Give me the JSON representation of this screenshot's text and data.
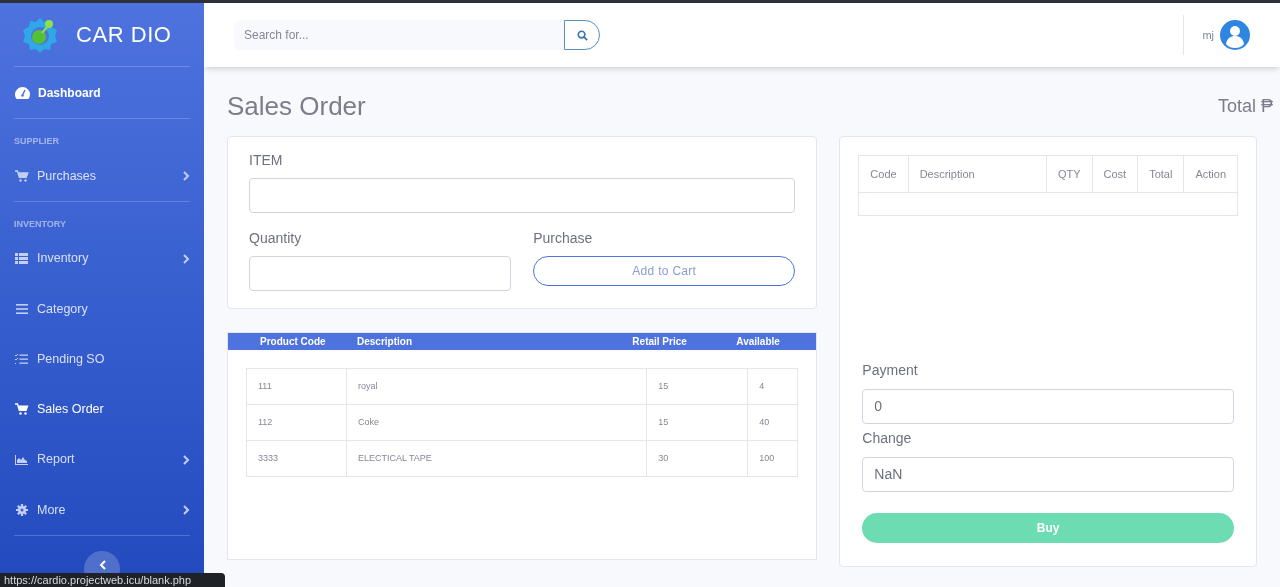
{
  "sidebar": {
    "brand": "CAR DIO",
    "dashboard": {
      "label": "Dashboard",
      "selected": false
    },
    "sections": [
      {
        "heading": "SUPPLIER",
        "items": [
          {
            "label": "Purchases",
            "expandable": true,
            "selected": false
          }
        ]
      },
      {
        "heading": "INVENTORY",
        "items": [
          {
            "label": "Inventory",
            "expandable": true,
            "selected": false
          },
          {
            "label": "Category",
            "expandable": false,
            "selected": false
          },
          {
            "label": "Pending SO",
            "expandable": false,
            "selected": false
          },
          {
            "label": "Sales Order",
            "expandable": false,
            "selected": true
          },
          {
            "label": "Report",
            "expandable": true,
            "selected": false
          },
          {
            "label": "More",
            "expandable": true,
            "selected": false
          }
        ]
      }
    ]
  },
  "topbar": {
    "search": {
      "placeholder": "Search for..."
    },
    "user": "mj"
  },
  "page": {
    "title": "Sales Order",
    "total": "Total ₱"
  },
  "item_form": {
    "item_label": "ITEM",
    "quantity_label": "Quantity",
    "purchase_label": "Purchase",
    "add_button": "Add to Cart"
  },
  "products": {
    "columns": [
      "Product Code",
      "Description",
      "Retail Price",
      "Available"
    ],
    "rows": [
      [
        "111",
        "royal",
        "15",
        "4"
      ],
      [
        "112",
        "Coke",
        "15",
        "40"
      ],
      [
        "3333",
        "ELECTICAL TAPE",
        "30",
        "100"
      ]
    ]
  },
  "cart": {
    "columns": [
      "Code",
      "Description",
      "QTY",
      "Cost",
      "Total",
      "Action"
    ]
  },
  "checkout": {
    "payment_label": "Payment",
    "payment": "0",
    "change_label": "Change",
    "change": "NaN",
    "buy_button": "Buy"
  },
  "status_url": "https://cardio.projectweb.icu/blank.php"
}
